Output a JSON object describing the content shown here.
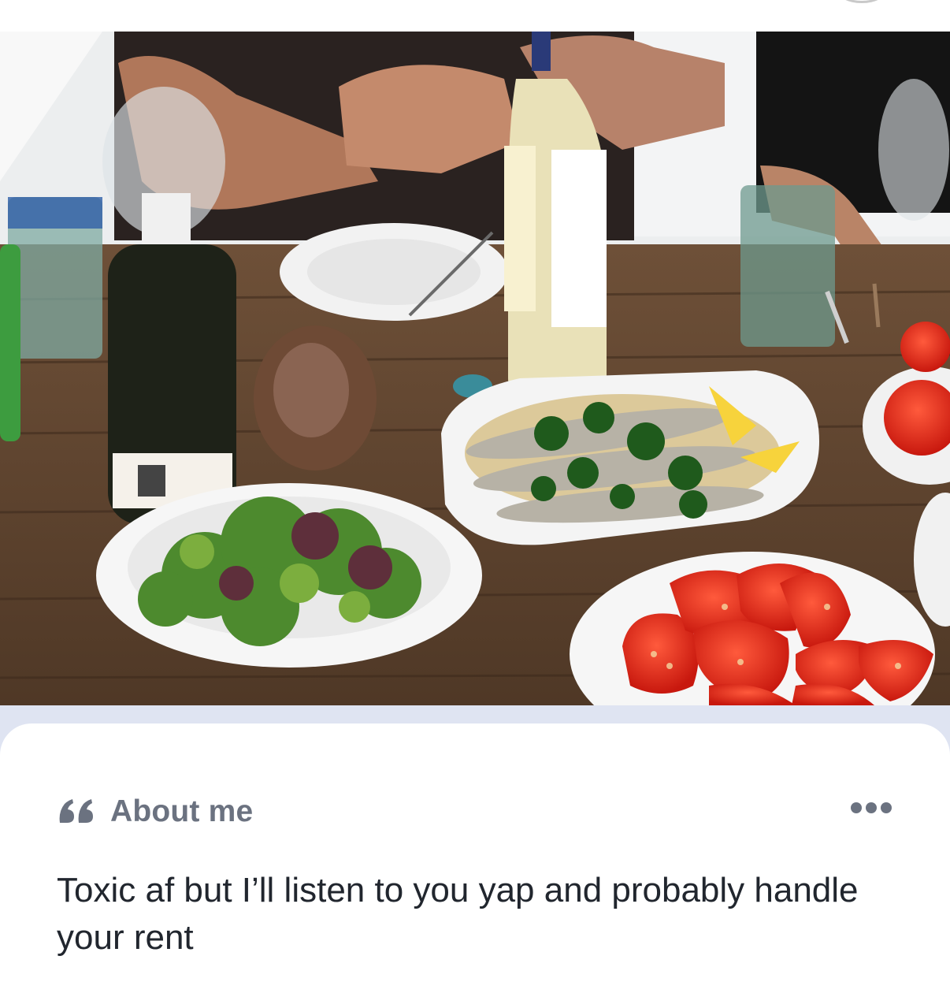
{
  "about": {
    "title": "About me",
    "bio": "Toxic af but I’ll listen to you yap and probably handle your rent"
  },
  "icons": {
    "quote": "quote-icon",
    "more": "more-options-icon"
  },
  "colors": {
    "background": "#ffffff",
    "separator": "#dfe4f2",
    "heading": "#6b7280",
    "body_text": "#21262e"
  }
}
